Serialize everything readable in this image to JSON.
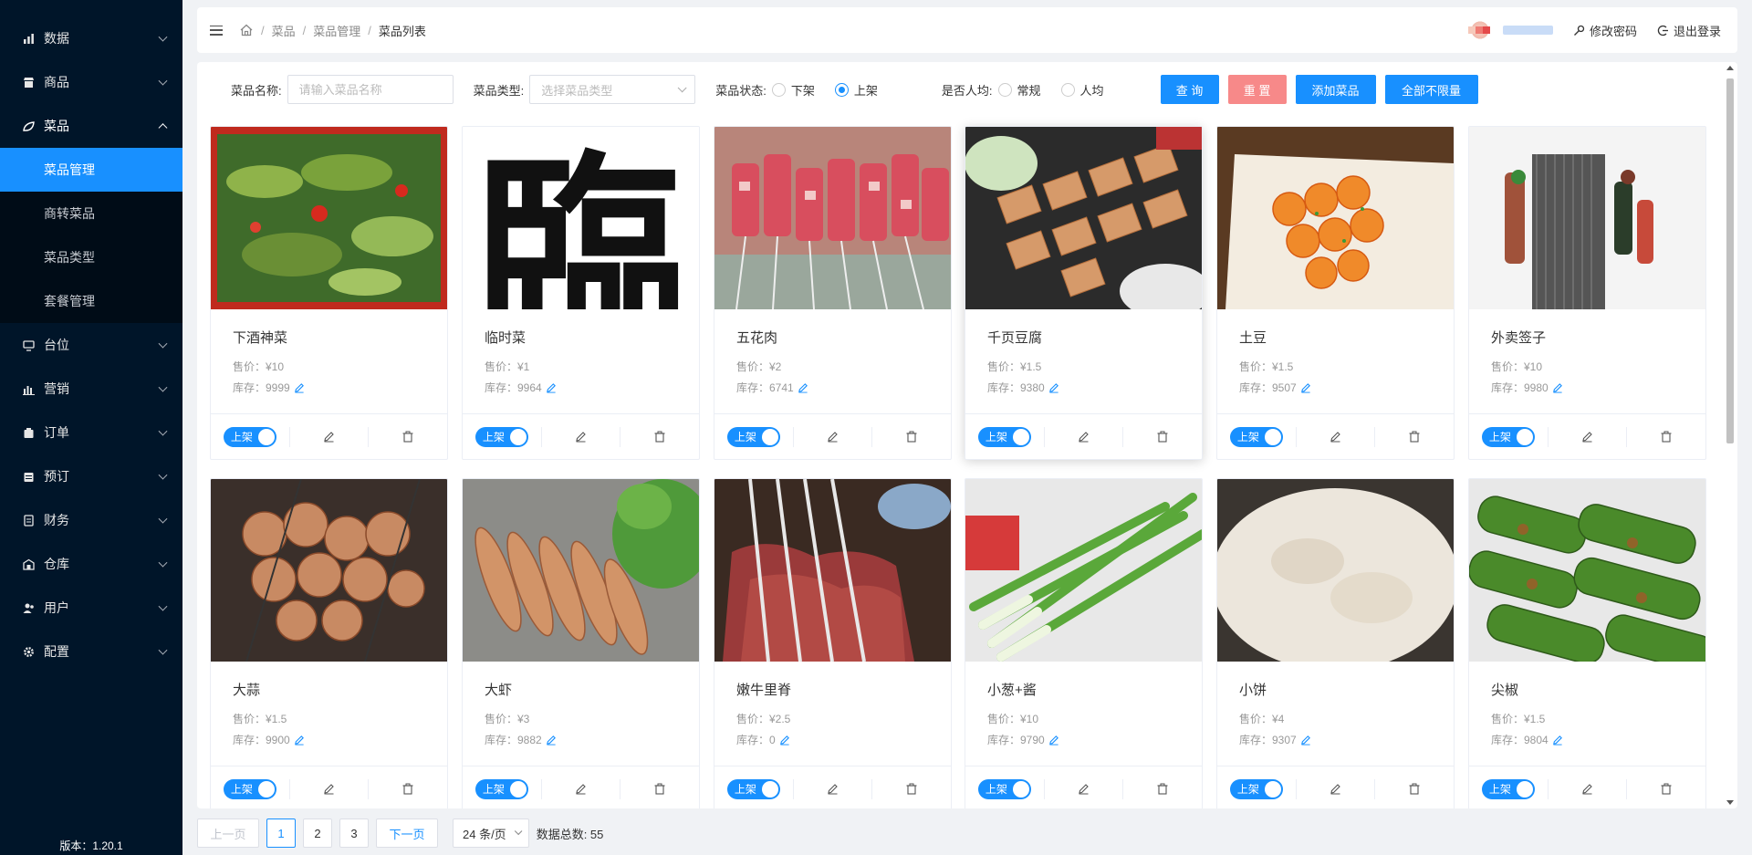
{
  "sidebar": {
    "menu": [
      {
        "label": "数据",
        "icon": "chart-icon"
      },
      {
        "label": "商品",
        "icon": "shop-icon"
      },
      {
        "label": "菜品",
        "icon": "leaf-icon"
      },
      {
        "label": "台位",
        "icon": "desk-icon"
      },
      {
        "label": "营销",
        "icon": "bar-chart-icon"
      },
      {
        "label": "订单",
        "icon": "order-icon"
      },
      {
        "label": "预订",
        "icon": "reserve-icon"
      },
      {
        "label": "财务",
        "icon": "finance-icon"
      },
      {
        "label": "仓库",
        "icon": "warehouse-icon"
      },
      {
        "label": "用户",
        "icon": "user-icon"
      },
      {
        "label": "配置",
        "icon": "gear-icon"
      }
    ],
    "submenu": [
      {
        "label": "菜品管理"
      },
      {
        "label": "商转菜品"
      },
      {
        "label": "菜品类型"
      },
      {
        "label": "套餐管理"
      }
    ],
    "version": "版本：1.20.1"
  },
  "header": {
    "breadcrumb": [
      "菜品",
      "菜品管理",
      "菜品列表"
    ],
    "sep": "/",
    "change_password": "修改密码",
    "logout": "退出登录"
  },
  "filters": {
    "name_label": "菜品名称:",
    "name_placeholder": "请输入菜品名称",
    "type_label": "菜品类型:",
    "type_placeholder": "选择菜品类型",
    "status_label": "菜品状态:",
    "status_off": "下架",
    "status_on": "上架",
    "per_person_label": "是否人均:",
    "per_person_normal": "常规",
    "per_person_avg": "人均",
    "btn_query": "查 询",
    "btn_reset": "重 置",
    "btn_add": "添加菜品",
    "btn_unlimit": "全部不限量"
  },
  "cards": [
    {
      "name": "下酒神菜",
      "price": "售价：¥10",
      "stock": "库存：9999",
      "status": "上架"
    },
    {
      "name": "临时菜",
      "price": "售价：¥1",
      "stock": "库存：9964",
      "status": "上架"
    },
    {
      "name": "五花肉",
      "price": "售价：¥2",
      "stock": "库存：6741",
      "status": "上架"
    },
    {
      "name": "千页豆腐",
      "price": "售价：¥1.5",
      "stock": "库存：9380",
      "status": "上架"
    },
    {
      "name": "土豆",
      "price": "售价：¥1.5",
      "stock": "库存：9507",
      "status": "上架"
    },
    {
      "name": "外卖签子",
      "price": "售价：¥10",
      "stock": "库存：9980",
      "status": "上架"
    },
    {
      "name": "大蒜",
      "price": "售价：¥1.5",
      "stock": "库存：9900",
      "status": "上架"
    },
    {
      "name": "大虾",
      "price": "售价：¥3",
      "stock": "库存：9882",
      "status": "上架"
    },
    {
      "name": "嫩牛里脊",
      "price": "售价：¥2.5",
      "stock": "库存：0",
      "status": "上架"
    },
    {
      "name": "小葱+酱",
      "price": "售价：¥10",
      "stock": "库存：9790",
      "status": "上架"
    },
    {
      "name": "小饼",
      "price": "售价：¥4",
      "stock": "库存：9307",
      "status": "上架"
    },
    {
      "name": "尖椒",
      "price": "售价：¥1.5",
      "stock": "库存：9804",
      "status": "上架"
    }
  ],
  "card_image_text": {
    "臨": "臨"
  },
  "pagination": {
    "prev": "上一页",
    "pages": [
      "1",
      "2",
      "3"
    ],
    "next": "下一页",
    "page_size": "24 条/页",
    "total": "数据总数:  55"
  }
}
